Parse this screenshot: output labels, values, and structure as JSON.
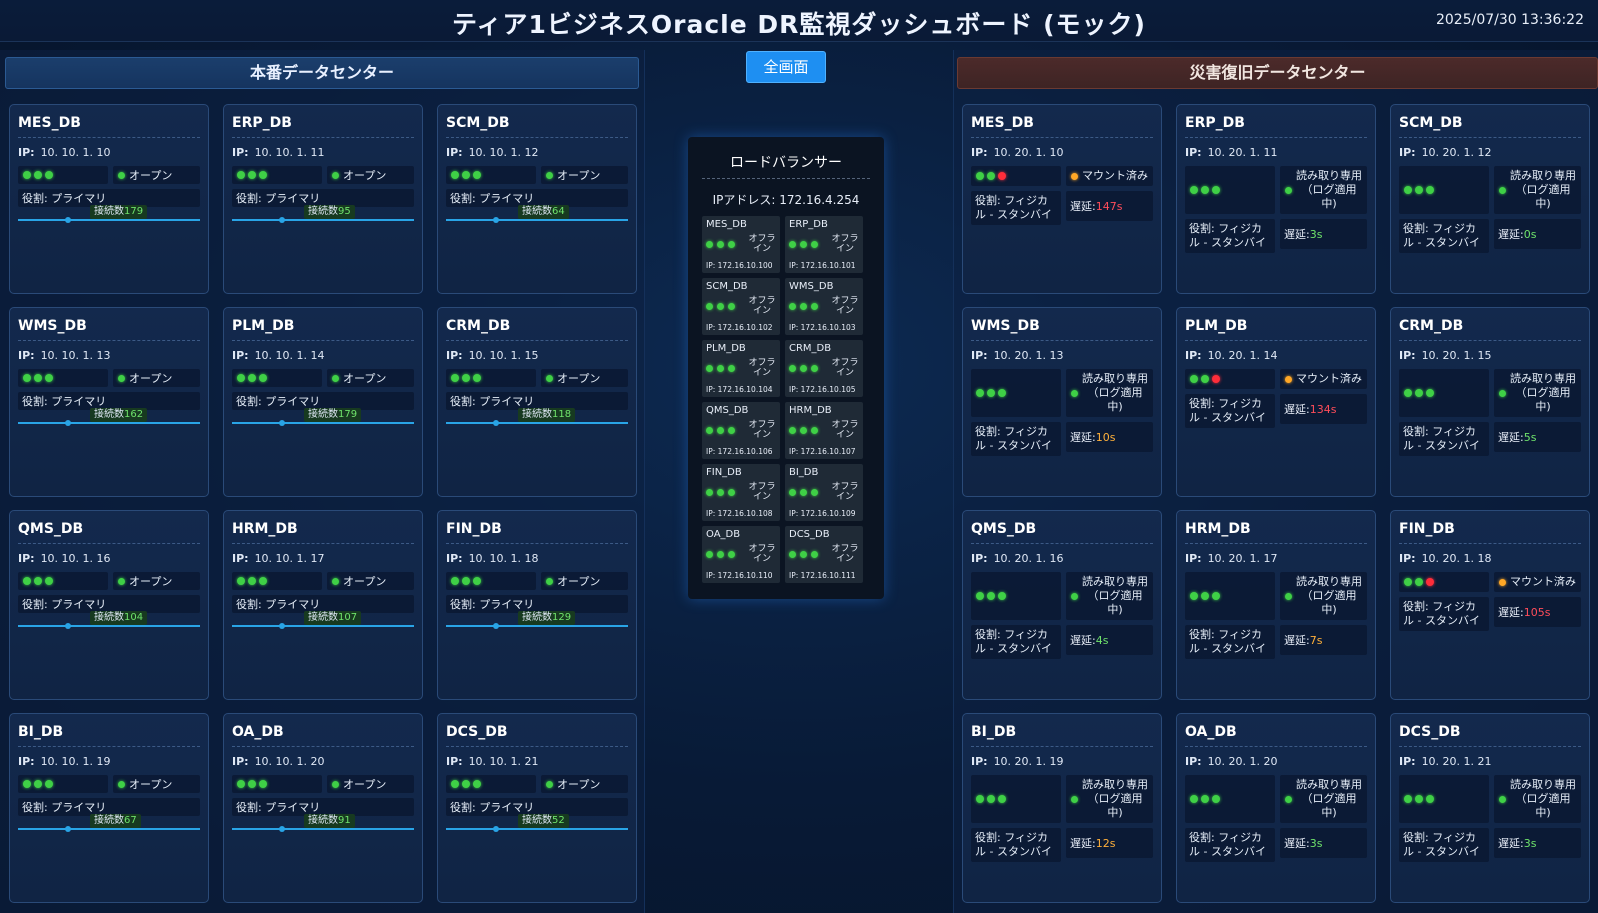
{
  "header": {
    "title": "ティア1ビジネスOracle DR監視ダッシュボード (モック)",
    "datetime": "2025/07/30 13:36:22"
  },
  "fullscreen_label": "全画面",
  "colors": {
    "ok": "#3fd046",
    "error": "#ff2d3a",
    "warning": "#ffa726",
    "accent": "#1e8ff2"
  },
  "prod": {
    "title": "本番データセンター",
    "ip_label": "IP:",
    "role_label": "役割: プライマリ",
    "conn_label": "接続数",
    "dbs": [
      {
        "name": "MES_DB",
        "ip": "10. 10. 1. 10",
        "status": "オープン",
        "conn": "179"
      },
      {
        "name": "ERP_DB",
        "ip": "10. 10. 1. 11",
        "status": "オープン",
        "conn": "95"
      },
      {
        "name": "SCM_DB",
        "ip": "10. 10. 1. 12",
        "status": "オープン",
        "conn": "64"
      },
      {
        "name": "WMS_DB",
        "ip": "10. 10. 1. 13",
        "status": "オープン",
        "conn": "162"
      },
      {
        "name": "PLM_DB",
        "ip": "10. 10. 1. 14",
        "status": "オープン",
        "conn": "179"
      },
      {
        "name": "CRM_DB",
        "ip": "10. 10. 1. 15",
        "status": "オープン",
        "conn": "118"
      },
      {
        "name": "QMS_DB",
        "ip": "10. 10. 1. 16",
        "status": "オープン",
        "conn": "104"
      },
      {
        "name": "HRM_DB",
        "ip": "10. 10. 1. 17",
        "status": "オープン",
        "conn": "107"
      },
      {
        "name": "FIN_DB",
        "ip": "10. 10. 1. 18",
        "status": "オープン",
        "conn": "129"
      },
      {
        "name": "BI_DB",
        "ip": "10. 10. 1. 19",
        "status": "オープン",
        "conn": "67"
      },
      {
        "name": "OA_DB",
        "ip": "10. 10. 1. 20",
        "status": "オープン",
        "conn": "91"
      },
      {
        "name": "DCS_DB",
        "ip": "10. 10. 1. 21",
        "status": "オープン",
        "conn": "52"
      }
    ]
  },
  "dr": {
    "title": "災害復旧データセンター",
    "ip_label": "IP:",
    "role_label": "役割: フィジカル - スタンバイ",
    "lag_label": "遅延:",
    "dbs": [
      {
        "name": "MES_DB",
        "ip": "10. 20. 1. 10",
        "dots": [
          "g",
          "g",
          "r"
        ],
        "status": "マウント済み",
        "status_color": "o",
        "lag": "147s",
        "lag_level": "red"
      },
      {
        "name": "ERP_DB",
        "ip": "10. 20. 1. 11",
        "dots": [
          "g",
          "g",
          "g"
        ],
        "status": "読み取り専用（ログ適用中)",
        "status_color": "g",
        "lag": "3s",
        "lag_level": "green"
      },
      {
        "name": "SCM_DB",
        "ip": "10. 20. 1. 12",
        "dots": [
          "g",
          "g",
          "g"
        ],
        "status": "読み取り専用（ログ適用中)",
        "status_color": "g",
        "lag": "0s",
        "lag_level": "green"
      },
      {
        "name": "WMS_DB",
        "ip": "10. 20. 1. 13",
        "dots": [
          "g",
          "g",
          "g"
        ],
        "status": "読み取り専用（ログ適用中)",
        "status_color": "g",
        "lag": "10s",
        "lag_level": "orange"
      },
      {
        "name": "PLM_DB",
        "ip": "10. 20. 1. 14",
        "dots": [
          "g",
          "g",
          "r"
        ],
        "status": "マウント済み",
        "status_color": "o",
        "lag": "134s",
        "lag_level": "red"
      },
      {
        "name": "CRM_DB",
        "ip": "10. 20. 1. 15",
        "dots": [
          "g",
          "g",
          "g"
        ],
        "status": "読み取り専用（ログ適用中)",
        "status_color": "g",
        "lag": "5s",
        "lag_level": "green"
      },
      {
        "name": "QMS_DB",
        "ip": "10. 20. 1. 16",
        "dots": [
          "g",
          "g",
          "g"
        ],
        "status": "読み取り専用（ログ適用中)",
        "status_color": "g",
        "lag": "4s",
        "lag_level": "green"
      },
      {
        "name": "HRM_DB",
        "ip": "10. 20. 1. 17",
        "dots": [
          "g",
          "g",
          "g"
        ],
        "status": "読み取り専用（ログ適用中)",
        "status_color": "g",
        "lag": "7s",
        "lag_level": "orange"
      },
      {
        "name": "FIN_DB",
        "ip": "10. 20. 1. 18",
        "dots": [
          "g",
          "g",
          "r"
        ],
        "status": "マウント済み",
        "status_color": "o",
        "lag": "105s",
        "lag_level": "red"
      },
      {
        "name": "BI_DB",
        "ip": "10. 20. 1. 19",
        "dots": [
          "g",
          "g",
          "g"
        ],
        "status": "読み取り専用（ログ適用中)",
        "status_color": "g",
        "lag": "12s",
        "lag_level": "orange"
      },
      {
        "name": "OA_DB",
        "ip": "10. 20. 1. 20",
        "dots": [
          "g",
          "g",
          "g"
        ],
        "status": "読み取り専用（ログ適用中)",
        "status_color": "g",
        "lag": "3s",
        "lag_level": "green"
      },
      {
        "name": "DCS_DB",
        "ip": "10. 20. 1. 21",
        "dots": [
          "g",
          "g",
          "g"
        ],
        "status": "読み取り専用（ログ適用中)",
        "status_color": "g",
        "lag": "3s",
        "lag_level": "green"
      }
    ]
  },
  "lb": {
    "title": "ロードバランサー",
    "ip_line": "IPアドレス:  172.16.4.254",
    "offline_label": "オフライン",
    "items": [
      {
        "name": "MES_DB",
        "ip": "IP: 172.16.10.100"
      },
      {
        "name": "ERP_DB",
        "ip": "IP: 172.16.10.101"
      },
      {
        "name": "SCM_DB",
        "ip": "IP: 172.16.10.102"
      },
      {
        "name": "WMS_DB",
        "ip": "IP: 172.16.10.103"
      },
      {
        "name": "PLM_DB",
        "ip": "IP: 172.16.10.104"
      },
      {
        "name": "CRM_DB",
        "ip": "IP: 172.16.10.105"
      },
      {
        "name": "QMS_DB",
        "ip": "IP: 172.16.10.106"
      },
      {
        "name": "HRM_DB",
        "ip": "IP: 172.16.10.107"
      },
      {
        "name": "FIN_DB",
        "ip": "IP: 172.16.10.108"
      },
      {
        "name": "BI_DB",
        "ip": "IP: 172.16.10.109"
      },
      {
        "name": "OA_DB",
        "ip": "IP: 172.16.10.110"
      },
      {
        "name": "DCS_DB",
        "ip": "IP: 172.16.10.111"
      }
    ]
  }
}
